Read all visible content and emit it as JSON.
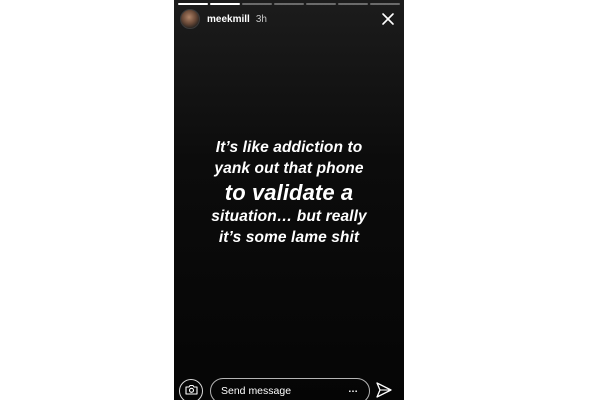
{
  "header": {
    "username": "meekmill",
    "time": "3h"
  },
  "progress": {
    "segments": 7,
    "current": 2
  },
  "story": {
    "lines": [
      "It’s like addiction to",
      "yank out that phone",
      "to validate a",
      "situation… but really",
      "it’s some lame shit"
    ],
    "background": "#0a0a0a"
  },
  "footer": {
    "message_placeholder": "Send message",
    "more": "…"
  },
  "icons": {
    "close": "close-icon",
    "camera": "camera-icon",
    "send": "send-icon",
    "more": "more-icon"
  }
}
